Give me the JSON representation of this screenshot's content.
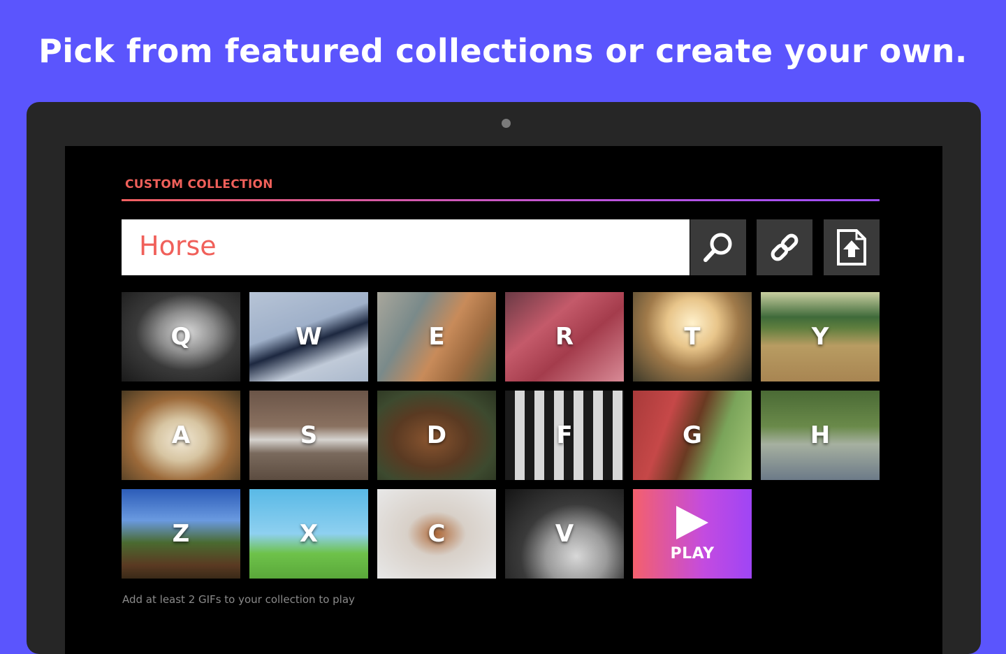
{
  "headline": "Pick from featured collections or create your own.",
  "collection": {
    "title": "CUSTOM COLLECTION",
    "search_value": "Horse",
    "hint": "Add at least 2 GIFs to your collection to play"
  },
  "toolbar": {
    "search_icon": "search-icon",
    "link_icon": "link-icon",
    "upload_icon": "file-upload-icon"
  },
  "tiles": [
    {
      "letter": "Q"
    },
    {
      "letter": "W"
    },
    {
      "letter": "E"
    },
    {
      "letter": "R"
    },
    {
      "letter": "T"
    },
    {
      "letter": "Y"
    },
    {
      "letter": "A"
    },
    {
      "letter": "S"
    },
    {
      "letter": "D"
    },
    {
      "letter": "F"
    },
    {
      "letter": "G"
    },
    {
      "letter": "H"
    },
    {
      "letter": "Z"
    },
    {
      "letter": "X"
    },
    {
      "letter": "C"
    },
    {
      "letter": "V"
    }
  ],
  "play": {
    "label": "PLAY"
  },
  "colors": {
    "background": "#5b55fd",
    "accent": "#f0605a",
    "play_gradient_start": "#f4606c",
    "play_gradient_end": "#9f45f5"
  }
}
